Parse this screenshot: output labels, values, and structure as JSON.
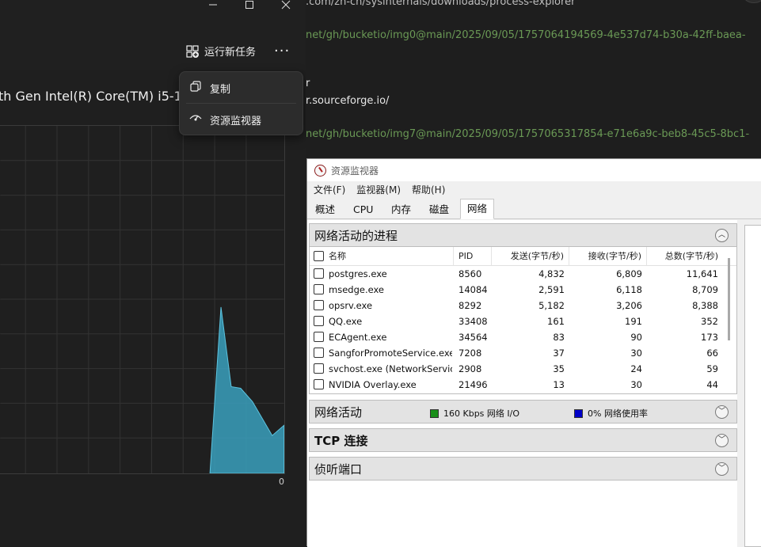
{
  "task_manager": {
    "toolbar": {
      "run_task_label": "运行新任务",
      "more_label": "···"
    },
    "cpu_name": "th Gen Intel(R) Core(TM) i5-1",
    "graph": {
      "axis_min_label": "0",
      "fill_color": "#3aa0bd",
      "grid_color": "#333333"
    },
    "context_menu": [
      {
        "label": "复制",
        "icon": "copy-icon"
      },
      {
        "label": "资源监视器",
        "icon": "resource-monitor-icon"
      }
    ]
  },
  "editor_lines": [
    {
      "text": ".com/zh-cn/sysinternals/downloads/process-explorer",
      "style": "grey"
    },
    {
      "text": "net/gh/bucketio/img0@main/2025/09/05/1757064194569-4e537d74-b30a-42ff-baea-",
      "style": "green"
    },
    {
      "text": "r",
      "style": "white"
    },
    {
      "text": "r.sourceforge.io/",
      "style": "white"
    },
    {
      "text": "net/gh/bucketio/img7@main/2025/09/05/1757065317854-e71e6a9c-beb8-45c5-8bc1-",
      "style": "green"
    }
  ],
  "resource_monitor": {
    "title": "资源监视器",
    "menu": [
      "文件(F)",
      "监视器(M)",
      "帮助(H)"
    ],
    "tabs": [
      "概述",
      "CPU",
      "内存",
      "磁盘",
      "网络"
    ],
    "active_tab": "网络",
    "sections": {
      "processes": "网络活动的进程",
      "activity": "网络活动",
      "tcp": "TCP 连接",
      "listening": "侦听端口"
    },
    "activity_legend": {
      "io_text": "160 Kbps 网络 I/O",
      "io_color": "#1a8f1a",
      "usage_text": "0% 网络使用率",
      "usage_color": "#0000c8"
    },
    "columns": [
      "名称",
      "PID",
      "发送(字节/秒)",
      "接收(字节/秒)",
      "总数(字节/秒)"
    ],
    "rows": [
      {
        "name": "postgres.exe",
        "pid": "8560",
        "send": "4,832",
        "recv": "6,809",
        "total": "11,641"
      },
      {
        "name": "msedge.exe",
        "pid": "14084",
        "send": "2,591",
        "recv": "6,118",
        "total": "8,709"
      },
      {
        "name": "opsrv.exe",
        "pid": "8292",
        "send": "5,182",
        "recv": "3,206",
        "total": "8,388"
      },
      {
        "name": "QQ.exe",
        "pid": "33408",
        "send": "161",
        "recv": "191",
        "total": "352"
      },
      {
        "name": "ECAgent.exe",
        "pid": "34564",
        "send": "83",
        "recv": "90",
        "total": "173"
      },
      {
        "name": "SangforPromoteService.exe",
        "pid": "7208",
        "send": "37",
        "recv": "30",
        "total": "66"
      },
      {
        "name": "svchost.exe (NetworkServic...",
        "pid": "2908",
        "send": "35",
        "recv": "24",
        "total": "59"
      },
      {
        "name": "NVIDIA Overlay.exe",
        "pid": "21496",
        "send": "13",
        "recv": "30",
        "total": "44"
      }
    ]
  }
}
